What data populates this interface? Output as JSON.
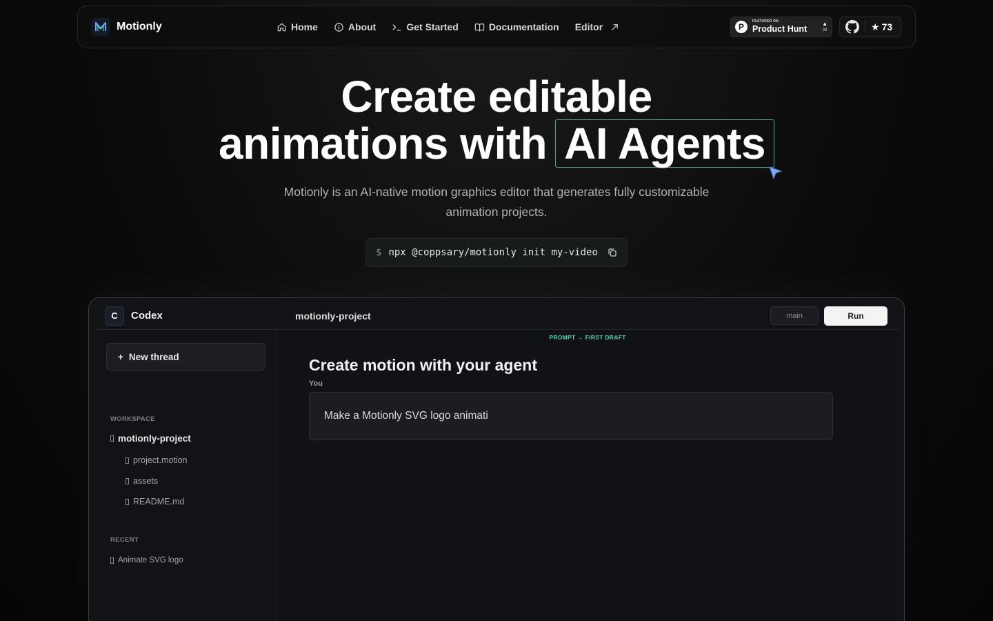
{
  "nav": {
    "brand": "Motionly",
    "links": [
      {
        "label": "Home",
        "icon": "home-icon"
      },
      {
        "label": "About",
        "icon": "info-icon"
      },
      {
        "label": "Get Started",
        "icon": "terminal-icon"
      },
      {
        "label": "Documentation",
        "icon": "book-icon"
      },
      {
        "label": "Editor",
        "icon": "external-arrow-icon"
      }
    ],
    "product_hunt": {
      "featured": "FEATURED ON",
      "name": "Product Hunt",
      "letter": "P",
      "votes": "93"
    },
    "github": {
      "stars": "73"
    }
  },
  "hero": {
    "title_line1": "Create editable",
    "title_line2a": "animations with",
    "title_highlight": "AI Agents",
    "subtitle": "Motionly is an AI-native motion graphics editor that generates fully customizable animation projects.",
    "command_prompt": "$",
    "command": "npx @coppsary/motionly init my-video"
  },
  "app": {
    "badge": "C",
    "name": "Codex",
    "project": "motionly-project",
    "branch": "main",
    "run": "Run",
    "new_thread": "New thread",
    "workspace_label": "WORKSPACE",
    "tree": {
      "root": "motionly-project",
      "children": [
        "project.motion",
        "assets",
        "README.md"
      ]
    },
    "recent_label": "RECENT",
    "recent_items": [
      "Animate SVG logo"
    ],
    "tag": "PROMPT → FIRST DRAFT",
    "main_title": "Create motion with your agent",
    "you_label": "You",
    "prompt": "Make a Motionly SVG logo animati"
  },
  "colors": {
    "accent": "#3fae92",
    "tag": "#4fd1a5",
    "cursor": "#7da7f0"
  }
}
